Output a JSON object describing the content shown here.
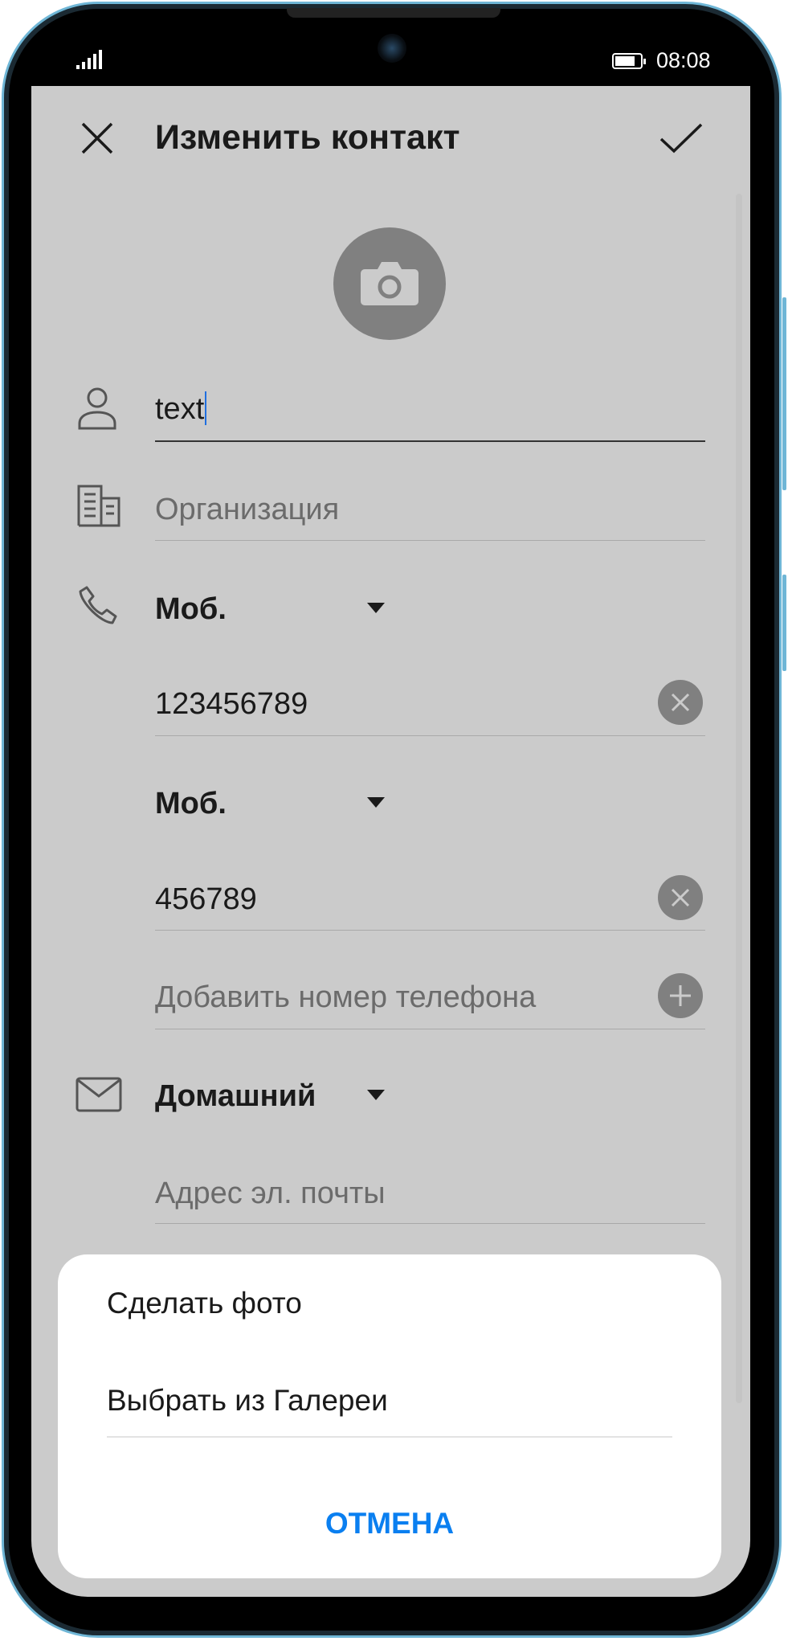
{
  "status_bar": {
    "time": "08:08",
    "signal_icon": "signal-icon",
    "battery_icon": "battery-icon"
  },
  "header": {
    "title": "Изменить контакт",
    "close_icon": "close-icon",
    "confirm_icon": "check-icon"
  },
  "photo": {
    "icon": "camera-icon"
  },
  "form": {
    "name_value": "text",
    "organization_placeholder": "Организация",
    "phones": [
      {
        "type": "Моб.",
        "value": "123456789"
      },
      {
        "type": "Моб.",
        "value": "456789"
      }
    ],
    "add_phone_placeholder": "Добавить номер телефона",
    "email_type": "Домашний",
    "email_placeholder": "Адрес эл. почты"
  },
  "sheet": {
    "items": [
      "Сделать фото",
      "Выбрать из Галереи"
    ],
    "cancel": "ОТМЕНА"
  },
  "colors": {
    "accent": "#0a7ff0",
    "background": "#cbcbcb",
    "icon_circle": "#808080"
  }
}
